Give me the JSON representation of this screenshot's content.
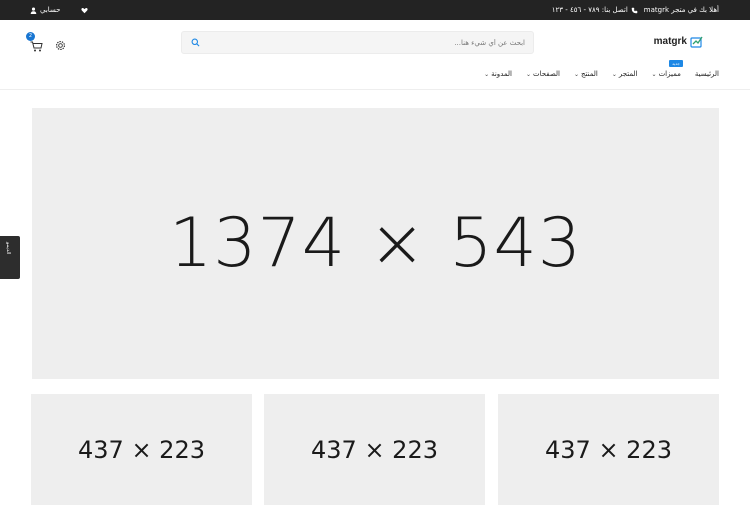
{
  "topbar": {
    "welcome": "أهلا بك في متجر matgrk",
    "phone_label": "اتصل بنا: ٧٨٩ - ٤٥٦ - ١٢٣",
    "account_label": "حسابي"
  },
  "header": {
    "logo_text": "matgrk",
    "search_placeholder": "ابحث عن أي شيء هنا...",
    "cart_count": "2"
  },
  "nav": {
    "items": [
      {
        "label": "الرئيسية",
        "has_dropdown": false
      },
      {
        "label": "مميزات",
        "has_dropdown": true,
        "badge": "جديد"
      },
      {
        "label": "المتجر",
        "has_dropdown": true
      },
      {
        "label": "المنتج",
        "has_dropdown": true
      },
      {
        "label": "الصفحات",
        "has_dropdown": true
      },
      {
        "label": "المدونة",
        "has_dropdown": true
      }
    ]
  },
  "side_tab": {
    "label": "الديمو"
  },
  "hero": {
    "placeholder": "1374 × 543"
  },
  "thumbs": [
    {
      "placeholder": "437 × 223"
    },
    {
      "placeholder": "437 × 223"
    },
    {
      "placeholder": "437 × 223"
    }
  ],
  "colors": {
    "accent": "#1e88e5",
    "topbar": "#232323",
    "placeholder_bg": "#eeeeee"
  }
}
